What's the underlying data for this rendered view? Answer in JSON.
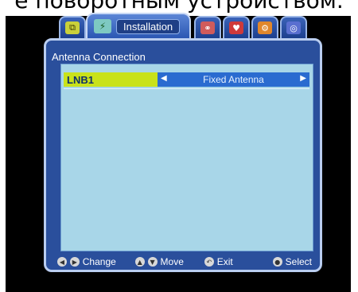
{
  "caption": "е поворотным устройством.",
  "tabs": [
    {
      "icon": "tv-icon",
      "glyph": "⧉"
    },
    {
      "icon": "antenna-icon",
      "glyph": "⚡",
      "label": "Installation",
      "active": true
    },
    {
      "icon": "media-icon",
      "glyph": "⚭"
    },
    {
      "icon": "lock-icon",
      "glyph": "♥"
    },
    {
      "icon": "settings-icon",
      "glyph": "⚙"
    },
    {
      "icon": "info-icon",
      "glyph": "◎"
    }
  ],
  "panel": {
    "title": "Antenna Connection",
    "row": {
      "label": "LNB1",
      "value": "Fixed Antenna",
      "left_arrow": "◀",
      "right_arrow": "▶"
    }
  },
  "footer": {
    "change": "Change",
    "move": "Move",
    "exit": "Exit",
    "select": "Select"
  },
  "colors": {
    "panel_bg": "#a8d6e8",
    "frame_bg": "#2a4f9c",
    "highlight": "#c9e21a",
    "value_bg": "#2a6bd0"
  }
}
